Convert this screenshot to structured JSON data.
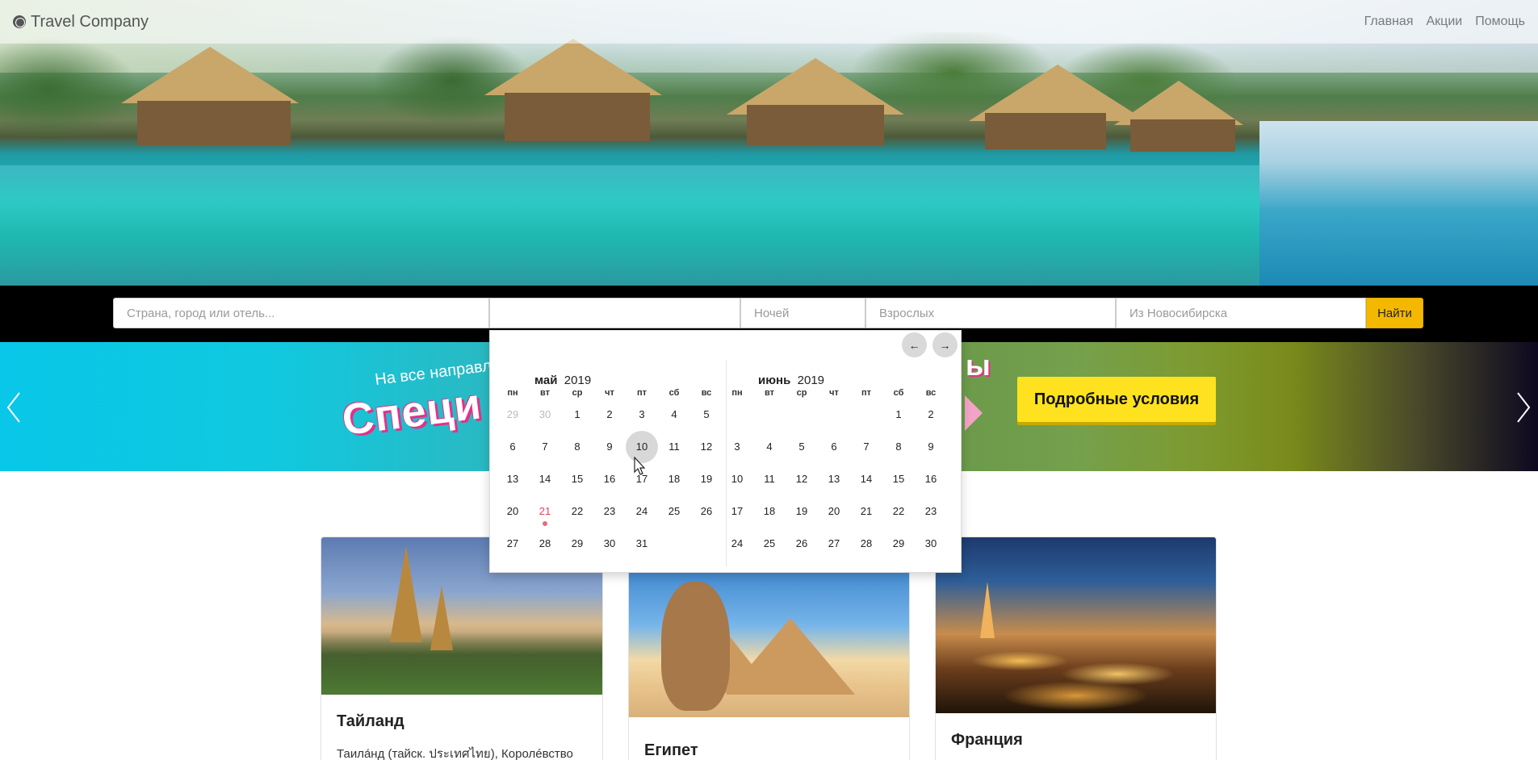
{
  "navbar": {
    "brand": "Travel Company",
    "links": [
      "Главная",
      "Акции",
      "Помощь"
    ]
  },
  "search": {
    "destination_placeholder": "Страна, город или отель...",
    "dates_value": "",
    "nights_placeholder": "Ночей",
    "adults_placeholder": "Взрослых",
    "from_placeholder": "Из Новосибирска",
    "find_label": "Найти"
  },
  "promo": {
    "subtitle": "На все направл",
    "title": "Специ",
    "tail_letters": "ы",
    "button_label": "Подробные условия"
  },
  "datepicker": {
    "prev_label": "←",
    "next_label": "→",
    "weekdays": [
      "пн",
      "вт",
      "ср",
      "чт",
      "пт",
      "сб",
      "вс"
    ],
    "months": [
      {
        "name": "май",
        "year": "2019",
        "weeks": [
          [
            "29",
            "30",
            "1",
            "2",
            "3",
            "4",
            "5"
          ],
          [
            "6",
            "7",
            "8",
            "9",
            "10",
            "11",
            "12"
          ],
          [
            "13",
            "14",
            "15",
            "16",
            "17",
            "18",
            "19"
          ],
          [
            "20",
            "21",
            "22",
            "23",
            "24",
            "25",
            "26"
          ],
          [
            "27",
            "28",
            "29",
            "30",
            "31",
            "",
            ""
          ]
        ]
      },
      {
        "name": "июнь",
        "year": "2019",
        "weeks": [
          [
            "",
            "",
            "",
            "",
            "",
            "1",
            "2"
          ],
          [
            "3",
            "4",
            "5",
            "6",
            "7",
            "8",
            "9"
          ],
          [
            "10",
            "11",
            "12",
            "13",
            "14",
            "15",
            "16"
          ],
          [
            "17",
            "18",
            "19",
            "20",
            "21",
            "22",
            "23"
          ],
          [
            "24",
            "25",
            "26",
            "27",
            "28",
            "29",
            "30"
          ]
        ]
      }
    ],
    "today": "21",
    "hovered": "10"
  },
  "cards": [
    {
      "title": "Тайланд",
      "text": "Таила́нд (тайск. ประเทศไทย), Королéвство"
    },
    {
      "title": "Египет",
      "text": ""
    },
    {
      "title": "Франция",
      "text": ""
    }
  ],
  "colors": {
    "accent_yellow": "#f5b800",
    "promo_button": "#ffe21f",
    "today_red": "#e0455a"
  }
}
